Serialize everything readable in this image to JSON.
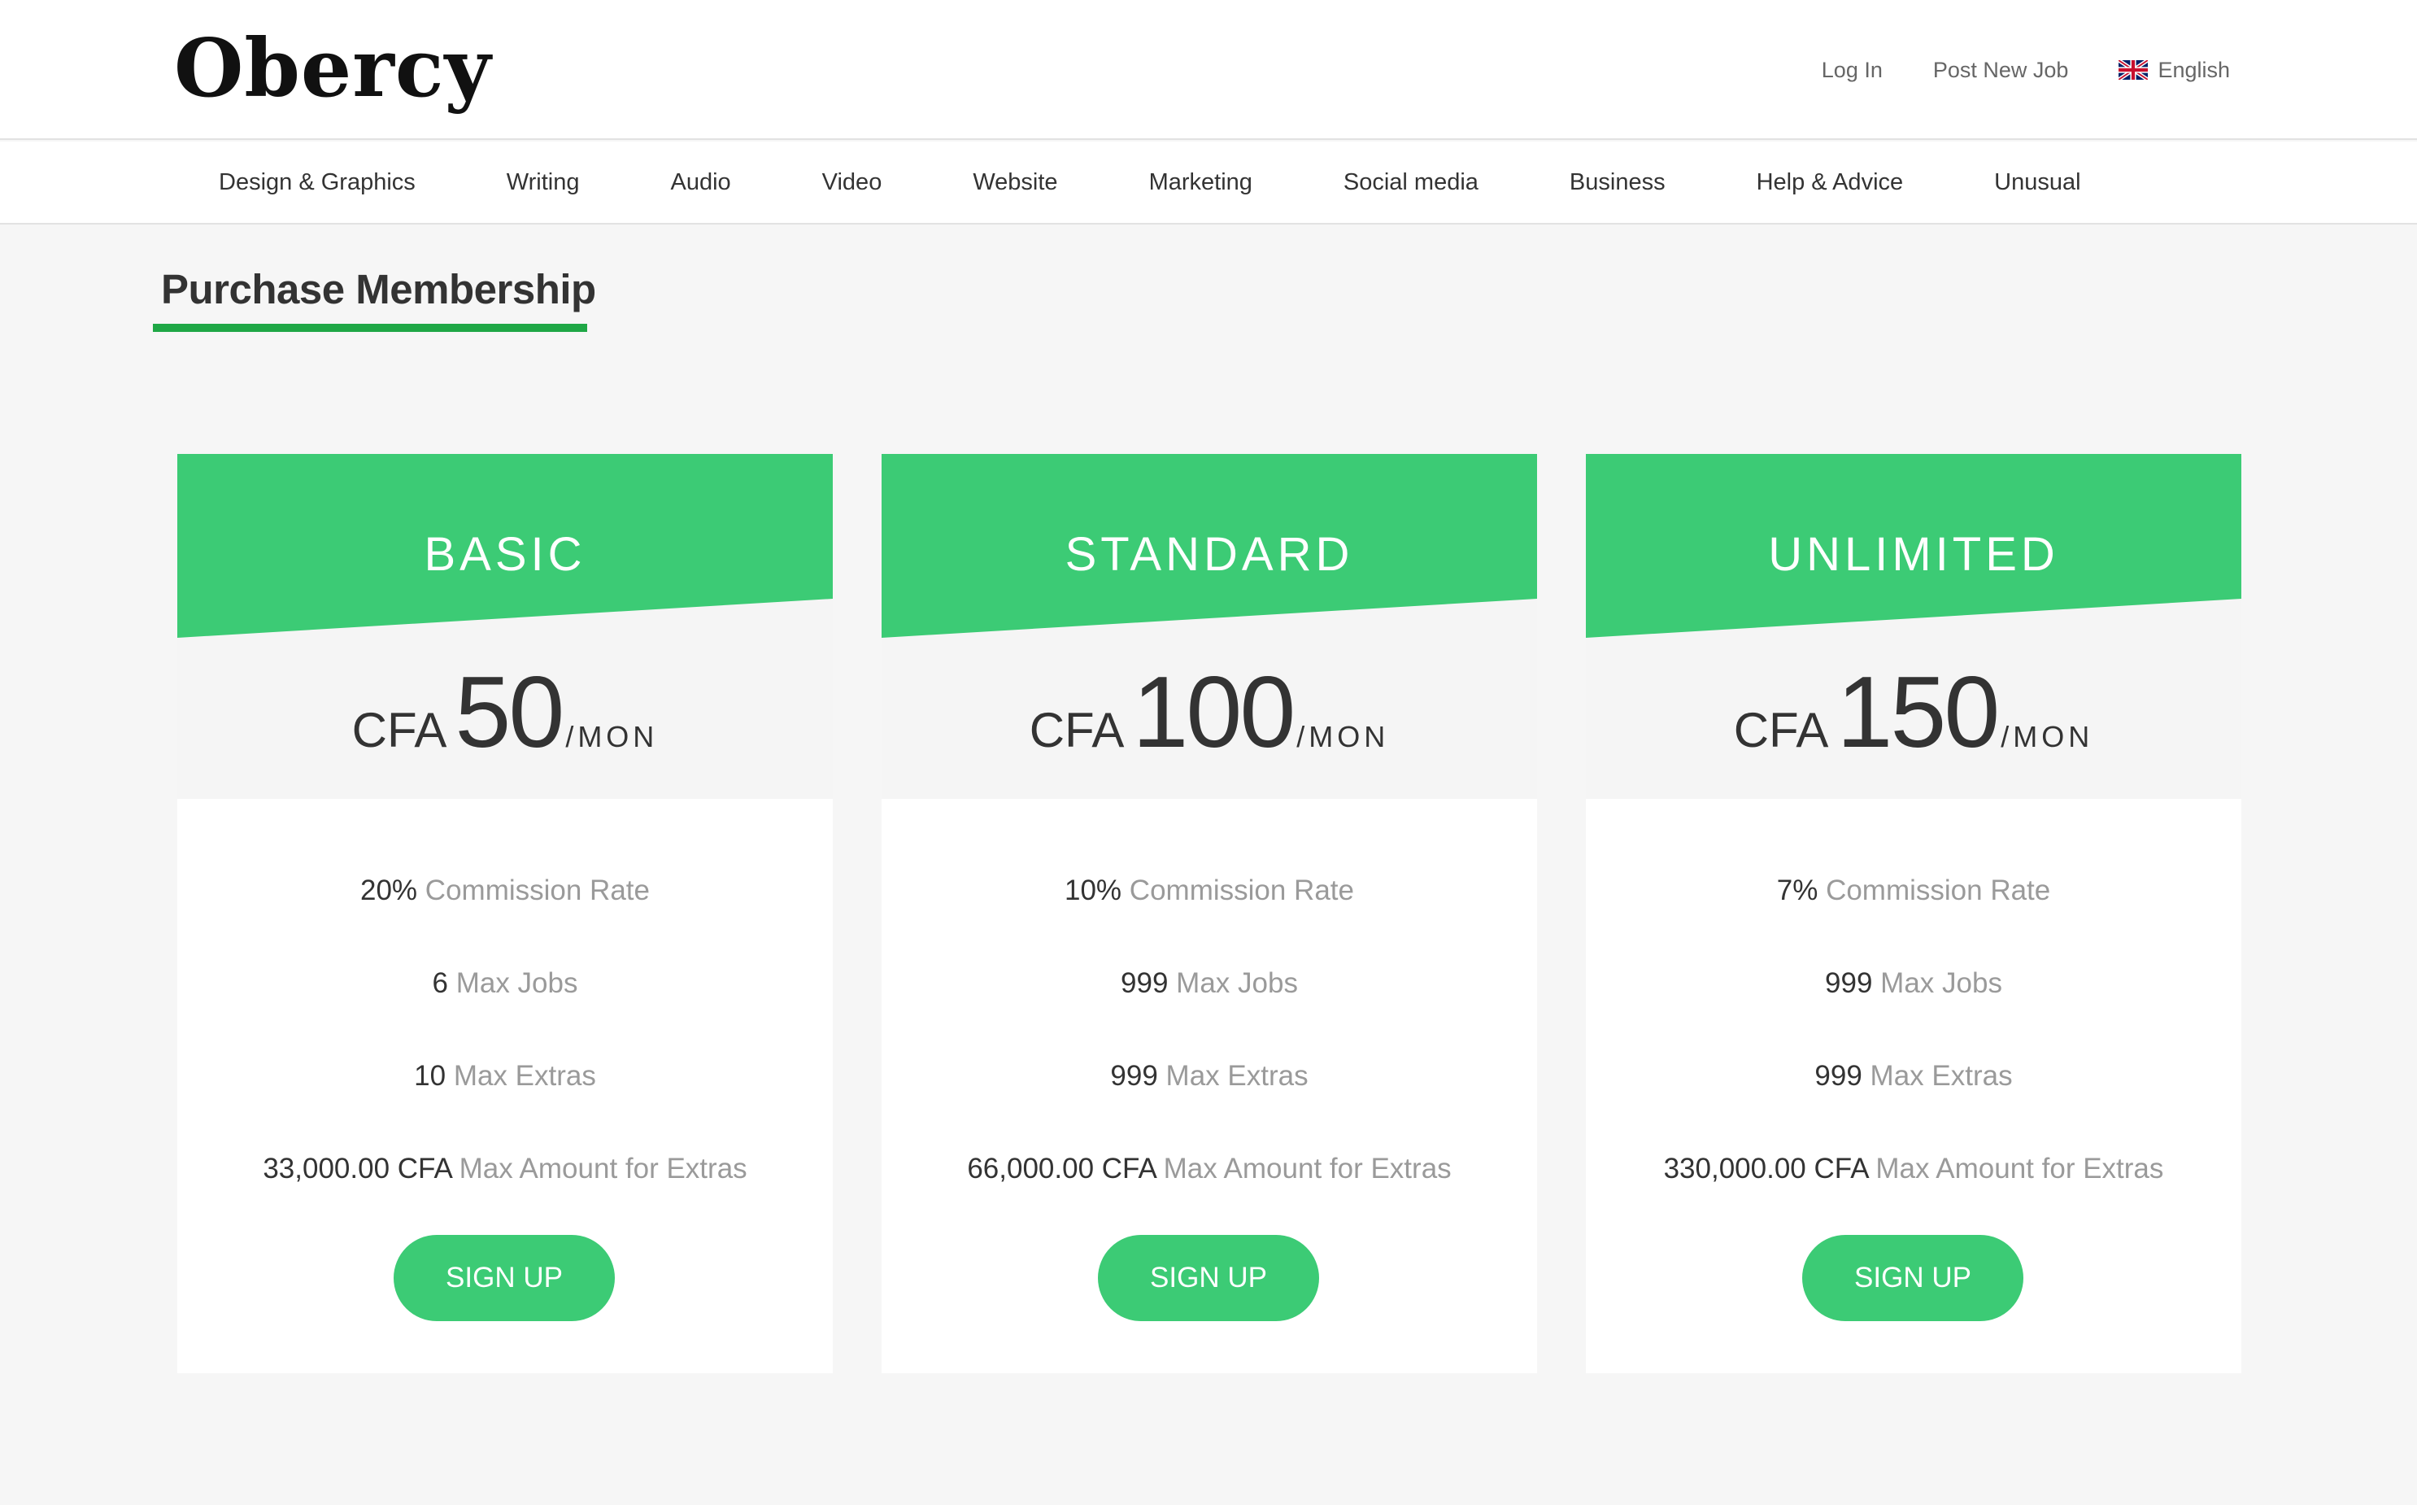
{
  "header": {
    "logo": "Obercy",
    "login": "Log In",
    "post_job": "Post New Job",
    "language": "English"
  },
  "categories": [
    "Design & Graphics",
    "Writing",
    "Audio",
    "Video",
    "Website",
    "Marketing",
    "Social media",
    "Business",
    "Help & Advice",
    "Unusual"
  ],
  "page": {
    "title": "Purchase Membership"
  },
  "plans": [
    {
      "name": "BASIC",
      "currency": "CFA",
      "price": "50",
      "period": "/MON",
      "commission": "20%",
      "commission_label": "Commission Rate",
      "max_jobs": "6",
      "max_jobs_label": "Max Jobs",
      "max_extras": "10",
      "max_extras_label": "Max Extras",
      "max_amount": "33,000.00 CFA",
      "max_amount_label": "Max Amount for Extras",
      "button": "SIGN UP"
    },
    {
      "name": "STANDARD",
      "currency": "CFA",
      "price": "100",
      "period": "/MON",
      "commission": "10%",
      "commission_label": "Commission Rate",
      "max_jobs": "999",
      "max_jobs_label": "Max Jobs",
      "max_extras": "999",
      "max_extras_label": "Max Extras",
      "max_amount": "66,000.00 CFA",
      "max_amount_label": "Max Amount for Extras",
      "button": "SIGN UP"
    },
    {
      "name": "UNLIMITED",
      "currency": "CFA",
      "price": "150",
      "period": "/MON",
      "commission": "7%",
      "commission_label": "Commission Rate",
      "max_jobs": "999",
      "max_jobs_label": "Max Jobs",
      "max_extras": "999",
      "max_extras_label": "Max Extras",
      "max_amount": "330,000.00 CFA",
      "max_amount_label": "Max Amount for Extras",
      "button": "SIGN UP"
    }
  ],
  "colors": {
    "accent": "#3ccb75",
    "underline": "#1fa746",
    "background": "#f6f6f6"
  }
}
